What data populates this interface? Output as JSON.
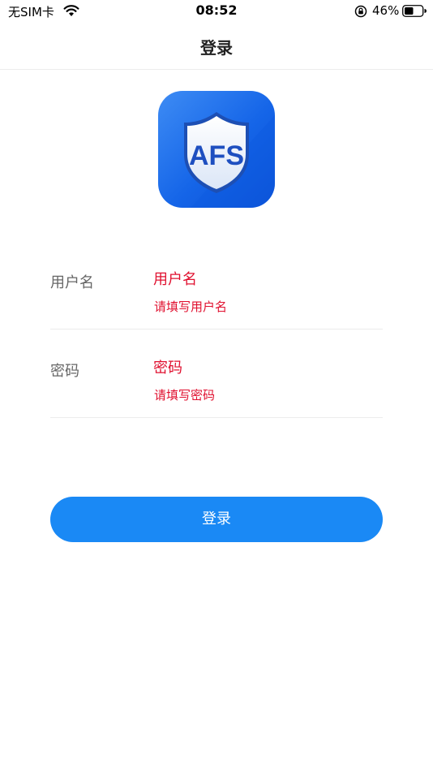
{
  "status_bar": {
    "carrier": "无SIM卡",
    "time": "08:52",
    "battery_percent": "46%",
    "icons": [
      "wifi-icon",
      "orientation-lock-icon",
      "battery-icon"
    ]
  },
  "nav": {
    "title": "登录"
  },
  "logo": {
    "text": "AFS",
    "colors": {
      "tile": "#1565e8",
      "shield": "#eef3fb",
      "letters": "#1e4fc0"
    }
  },
  "form": {
    "username": {
      "label": "用户名",
      "placeholder": "用户名",
      "error": "请填写用户名"
    },
    "password": {
      "label": "密码",
      "placeholder": "密码",
      "error": "请填写密码"
    }
  },
  "login_button": {
    "label": "登录"
  },
  "colors": {
    "accent": "#1a89f5",
    "error": "#e0102f",
    "label": "#666666"
  }
}
